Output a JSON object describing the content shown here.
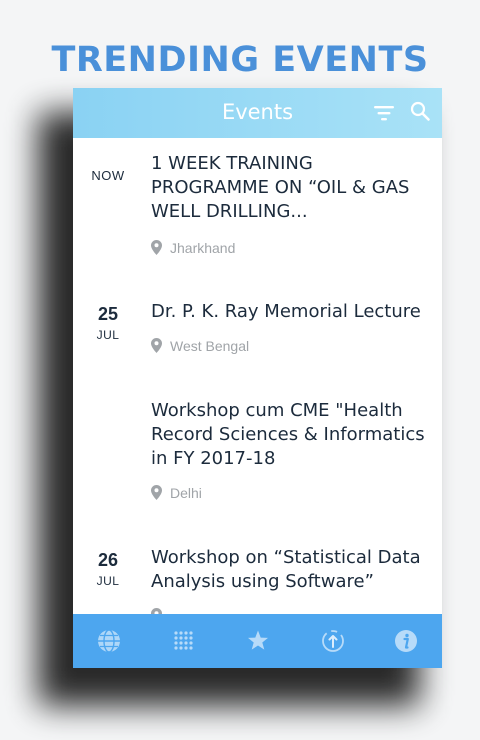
{
  "headline": "TRENDING EVENTS",
  "appbar": {
    "title": "Events",
    "filter_icon": "filter-icon",
    "search_icon": "search-icon"
  },
  "events": [
    {
      "date_label": "NOW",
      "day": "",
      "month": "",
      "title": "1 WEEK TRAINING PROGRAMME ON “OIL & GAS WELL DRILLING...",
      "location": "Jharkhand"
    },
    {
      "date_label": "",
      "day": "25",
      "month": "JUL",
      "title": "Dr. P. K. Ray Memorial Lecture",
      "location": "West Bengal"
    },
    {
      "date_label": "",
      "day": "",
      "month": "",
      "title": "Workshop cum CME  \"Health Record Sciences & Informatics in FY 2017-18",
      "location": "Delhi"
    },
    {
      "date_label": "",
      "day": "26",
      "month": "JUL",
      "title": "Workshop on “Statistical Data Analysis using Software”",
      "location": ""
    }
  ],
  "tabs": [
    {
      "name": "globe-icon"
    },
    {
      "name": "dots-grid-icon"
    },
    {
      "name": "star-icon"
    },
    {
      "name": "clock-arrow-icon"
    },
    {
      "name": "info-icon"
    }
  ],
  "colors": {
    "headline": "#4a90d9",
    "appbar_start": "#8ad2f3",
    "appbar_end": "#a9e2f7",
    "tabbar": "#4da6ef",
    "text_dark": "#1c2b3c",
    "text_muted": "#a0a4a8"
  }
}
